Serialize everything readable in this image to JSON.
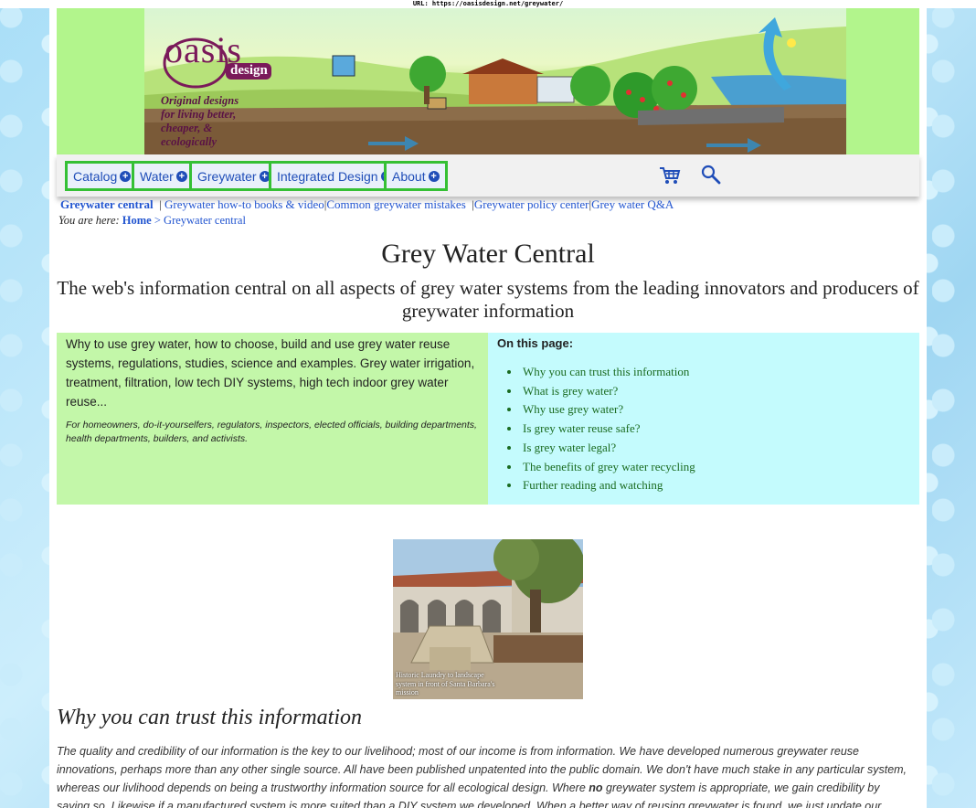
{
  "browser": {
    "url": "URL: https://oasisdesign.net/greywater/"
  },
  "banner": {
    "logo_word": "oasis",
    "logo_sub": "design",
    "tagline": [
      "Original designs",
      "for living better,",
      "cheaper, &",
      "ecologically"
    ]
  },
  "nav": {
    "items": [
      {
        "label": "Catalog"
      },
      {
        "label": "Water"
      },
      {
        "label": "Greywater"
      },
      {
        "label": "Integrated Design"
      },
      {
        "label": "About"
      }
    ],
    "cart_icon": "shopping-cart-icon",
    "search_icon": "search-icon"
  },
  "sublinks": {
    "current": "Greywater central",
    "items": [
      "Greywater how-to books & video",
      "Common greywater mistakes",
      "Greywater policy center",
      "Grey water Q&A"
    ]
  },
  "breadcrumb": {
    "label": "You are here:",
    "home": "Home",
    "sep": ">",
    "current": "Greywater central"
  },
  "title": "Grey Water Central",
  "subtitle": "The web's information central on all aspects of grey water systems from the leading innovators and producers of greywater information",
  "intro": {
    "main": "Why to use grey water, how to choose, build and use grey water reuse systems, regulations, studies, science and examples. Grey water irrigation, treatment, filtration, low tech DIY systems, high tech indoor grey water reuse...",
    "audience": "For homeowners, do-it-yourselfers, regulators, inspectors, elected officials, building departments, health departments, builders, and activists."
  },
  "toc": {
    "heading": "On this page:",
    "items": [
      "Why you can trust this information",
      "What is grey water?",
      "Why use grey water?",
      "Is grey water reuse safe?",
      "Is grey water legal?",
      "The benefits of grey water recycling",
      "Further reading and watching"
    ]
  },
  "photo": {
    "caption": "Historic Laundry to landscape system in front of Santa Barbara's mission"
  },
  "section": {
    "heading": "Why you can trust this information",
    "p1": "The quality and credibility of our information is the key to our livelihood; most of our income is from information. We have developed numerous greywater reuse innovations, perhaps more than any other single source. All have been published unpatented into the public domain. We don't have much stake in any particular system, whereas our livlihood depends on being a trustworthy information source for all ecological design. Where ",
    "p1_bold": "no",
    "p2": " greywater system is appropriate, we gain credibility by saying so. Likewise if a manufactured system is more suited than a DIY system we developed. When a better way of reusing greywater is found, we just update our information—we don't have a"
  },
  "colors": {
    "banner_green": "#b2f58c",
    "nav_border": "#35c035",
    "link_blue": "#2255d0",
    "intro_green": "#c3f7a9",
    "toc_cyan": "#c4fbfd",
    "toc_link": "#1a6b20"
  }
}
